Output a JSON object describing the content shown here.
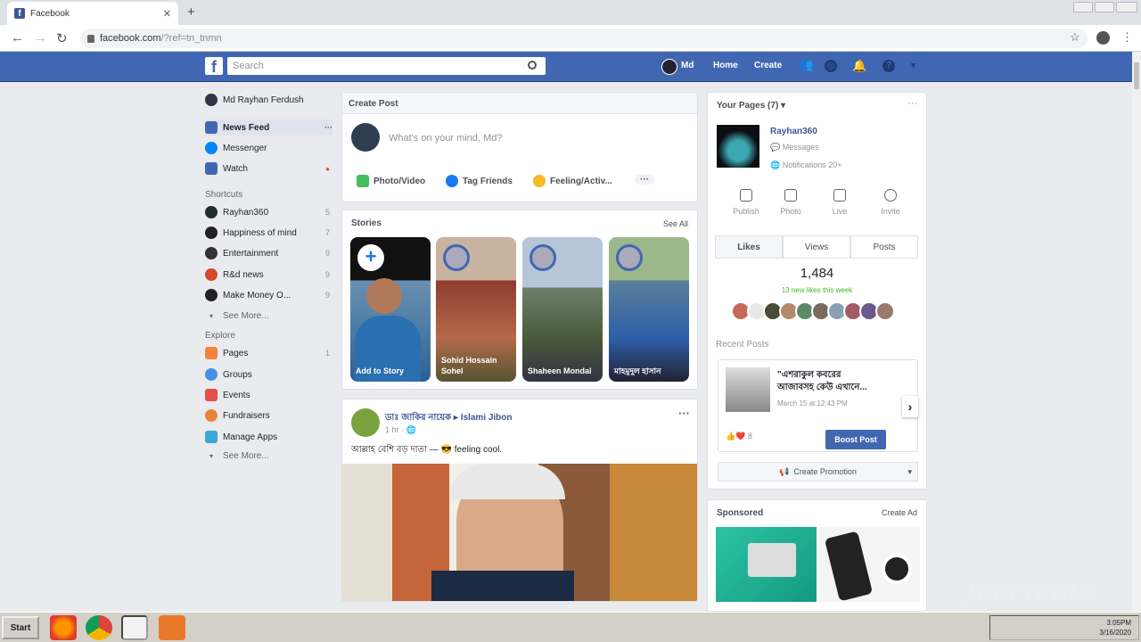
{
  "browser": {
    "tab_title": "Facebook",
    "url_domain": "facebook.com",
    "url_path": "/?ref=tn_tnmn"
  },
  "header": {
    "search_placeholder": "Search",
    "user_short": "Md",
    "home": "Home",
    "create": "Create"
  },
  "left_nav": {
    "profile_name": "Md Rayhan Ferdush",
    "main": [
      {
        "label": "News Feed",
        "icon": "news-feed-icon",
        "extra": "···"
      },
      {
        "label": "Messenger",
        "icon": "messenger-icon"
      },
      {
        "label": "Watch",
        "icon": "watch-icon"
      }
    ],
    "shortcuts_label": "Shortcuts",
    "shortcuts": [
      {
        "label": "Rayhan360",
        "count": "5"
      },
      {
        "label": "Happiness of mind",
        "count": "7"
      },
      {
        "label": "Entertainment",
        "count": "9"
      },
      {
        "label": "R&d news",
        "count": "9"
      },
      {
        "label": "Make Money O...",
        "count": "9"
      }
    ],
    "see_more_1": "See More...",
    "explore_label": "Explore",
    "explore": [
      {
        "label": "Pages",
        "count": "1"
      },
      {
        "label": "Groups",
        "count": ""
      },
      {
        "label": "Events",
        "count": ""
      },
      {
        "label": "Fundraisers",
        "count": ""
      },
      {
        "label": "Manage Apps",
        "count": ""
      }
    ],
    "see_more_2": "See More..."
  },
  "create_post": {
    "title": "Create Post",
    "placeholder": "What's on your mind, Md?",
    "photo_video": "Photo/Video",
    "tag_friends": "Tag Friends",
    "feeling": "Feeling/Activ...",
    "more": "···"
  },
  "stories": {
    "title": "Stories",
    "see_all": "See All",
    "items": [
      {
        "caption": "Add to Story"
      },
      {
        "caption": "Sohid Hossain Sohel"
      },
      {
        "caption": "Shaheen Mondal"
      },
      {
        "caption": "মাহমুদুল হাসান"
      }
    ]
  },
  "post": {
    "author": "ডাঃ জাকির নায়েক ▸ Islami Jibon",
    "time": "1 hr · 🌐",
    "text": "আল্লাহ বেশি বড় দাতা — 😎 feeling cool."
  },
  "pages_panel": {
    "title": "Your Pages (7) ▾",
    "more": "···",
    "page_name": "Rayhan360",
    "messages": "Messages",
    "notifications": "Notifications",
    "notifications_count": "20+",
    "actions": [
      "Publish",
      "Photo",
      "Live",
      "Invite"
    ],
    "tabs": [
      "Likes",
      "Views",
      "Posts"
    ],
    "likes_count": "1,484",
    "likes_sub": "13 new likes this week",
    "recent_posts": "Recent Posts",
    "recent_text": "\"এশরাকুল কবরের আজাবসহ কেউ এখানে...",
    "recent_date": "March 15 at 12:43 PM",
    "reactions": "8",
    "boost": "Boost Post",
    "create_promotion": "Create Promotion"
  },
  "sponsored": {
    "title": "Sponsored",
    "create_ad": "Create Ad"
  },
  "taskbar": {
    "start": "Start",
    "clock_time": "3:05PM",
    "clock_date": "3/16/2020"
  },
  "colors": {
    "fb_blue": "#4267b2",
    "bg": "#e9ebee",
    "boost": "#4267b2"
  }
}
